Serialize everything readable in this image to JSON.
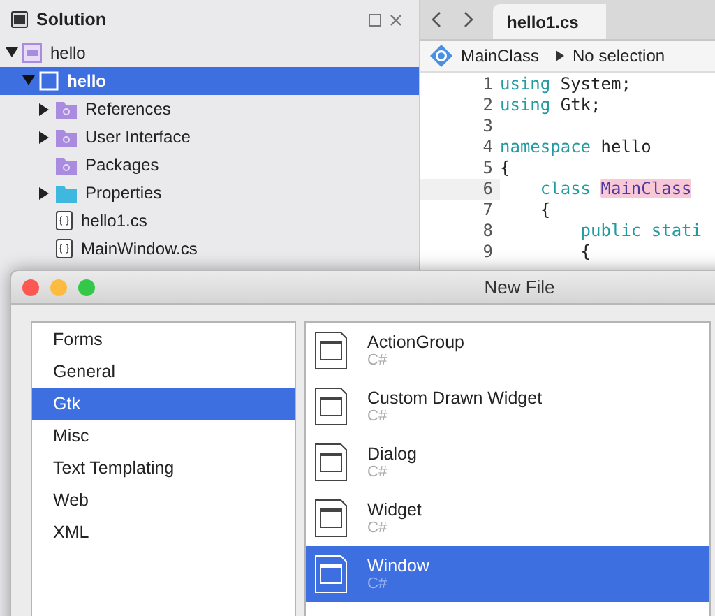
{
  "solution_pad": {
    "title": "Solution",
    "tree": [
      {
        "label": "hello",
        "kind": "solution",
        "expanded": true,
        "selected": false,
        "children": [
          {
            "label": "hello",
            "kind": "project",
            "expanded": true,
            "selected": true,
            "children": [
              {
                "label": "References",
                "kind": "references",
                "expanded": false,
                "selected": false
              },
              {
                "label": "User Interface",
                "kind": "ui-folder",
                "expanded": false,
                "selected": false
              },
              {
                "label": "Packages",
                "kind": "references",
                "selected": false
              },
              {
                "label": "Properties",
                "kind": "folder",
                "expanded": false,
                "selected": false
              },
              {
                "label": "hello1.cs",
                "kind": "file",
                "selected": false
              },
              {
                "label": "MainWindow.cs",
                "kind": "file",
                "selected": false
              }
            ]
          }
        ]
      }
    ]
  },
  "editor": {
    "tabs": [
      {
        "label": "hello1.cs",
        "selected": true
      }
    ],
    "breadcrumb": {
      "type": "MainClass",
      "member": "No selection"
    },
    "lines": [
      {
        "number": "1",
        "current": false,
        "tokens": [
          {
            "kind": "keyword",
            "text": "using"
          },
          {
            "kind": "plain",
            "text": "System;",
            "space_before": true
          }
        ]
      },
      {
        "number": "2",
        "current": false,
        "tokens": [
          {
            "kind": "keyword",
            "text": "using"
          },
          {
            "kind": "plain",
            "text": "Gtk;",
            "space_before": true
          }
        ]
      },
      {
        "number": "3",
        "current": false
      },
      {
        "number": "4",
        "current": false,
        "tokens": [
          {
            "kind": "keyword",
            "text": "namespace"
          },
          {
            "kind": "plain",
            "text": "hello",
            "space_before": true
          }
        ]
      },
      {
        "number": "5",
        "current": false,
        "tokens": [
          {
            "kind": "plain",
            "text": "{"
          }
        ]
      },
      {
        "number": "6",
        "current": true,
        "tokens": [
          {
            "kind": "keyword",
            "text": "    class"
          },
          {
            "kind": "highlight",
            "text": "MainClass",
            "space_before": true
          }
        ]
      },
      {
        "number": "7",
        "current": false,
        "tokens": [
          {
            "kind": "plain",
            "text": "    {"
          }
        ]
      },
      {
        "number": "8",
        "current": false,
        "tokens": [
          {
            "kind": "keyword",
            "text": "        public stati"
          }
        ]
      },
      {
        "number": "9",
        "current": false,
        "tokens": [
          {
            "kind": "plain",
            "text": "        {"
          }
        ]
      }
    ]
  },
  "dialog": {
    "title": "New File",
    "categories": [
      {
        "label": "Forms",
        "selected": false
      },
      {
        "label": "General",
        "selected": false
      },
      {
        "label": "Gtk",
        "selected": true
      },
      {
        "label": "Misc",
        "selected": false
      },
      {
        "label": "Text Templating",
        "selected": false
      },
      {
        "label": "Web",
        "selected": false
      },
      {
        "label": "XML",
        "selected": false
      }
    ],
    "templates": [
      {
        "name": "ActionGroup",
        "language": "C#",
        "selected": false
      },
      {
        "name": "Custom Drawn Widget",
        "language": "C#",
        "selected": false
      },
      {
        "name": "Dialog",
        "language": "C#",
        "selected": false
      },
      {
        "name": "Widget",
        "language": "C#",
        "selected": false
      },
      {
        "name": "Window",
        "language": "C#",
        "selected": true
      }
    ]
  }
}
